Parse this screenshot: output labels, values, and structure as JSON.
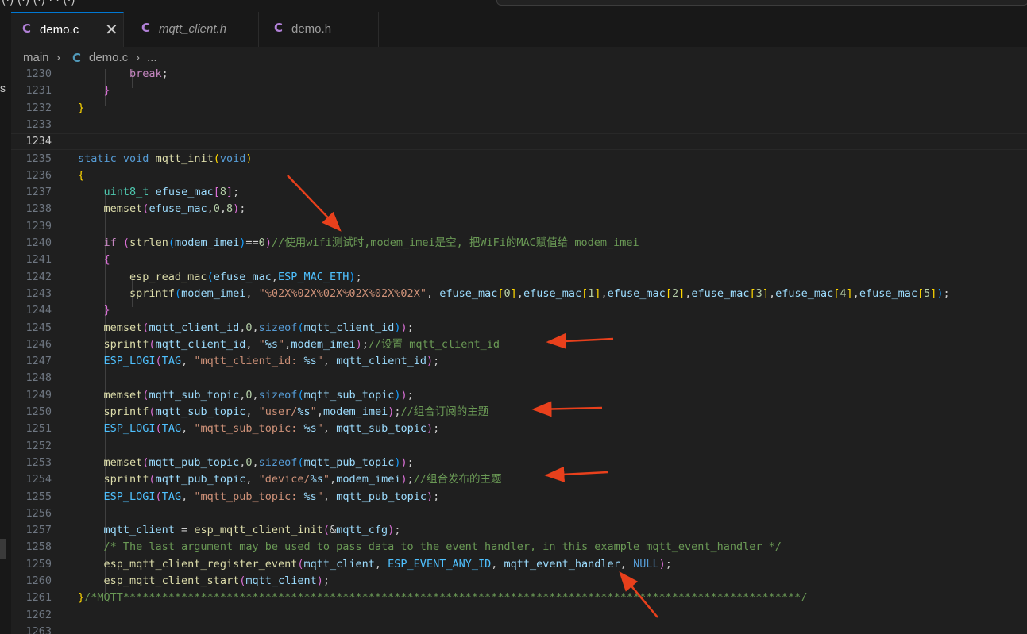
{
  "window": {
    "menu_remnant": "(·)  (·)  (·)  ·  ·  (·)"
  },
  "edge_label": "s",
  "tabs": [
    {
      "icon": "C",
      "label": "demo.c",
      "active": true,
      "italic": false,
      "close": "✕"
    },
    {
      "icon": "C",
      "label": "mqtt_client.h",
      "active": false,
      "italic": true
    },
    {
      "icon": "C",
      "label": "demo.h",
      "active": false,
      "italic": false
    }
  ],
  "breadcrumb": {
    "folder": "main",
    "sep1": "›",
    "icon": "C",
    "file": "demo.c",
    "sep2": "›",
    "tail": "..."
  },
  "colors": {
    "keyword": "#569cd6",
    "type": "#4ec9b0",
    "function": "#dcdcaa",
    "variable": "#9cdcfe",
    "number": "#b5cea8",
    "string": "#ce9178",
    "comment": "#6a9955",
    "macro": "#4fc1ff",
    "control": "#c586c0",
    "accent_tab": "#0078d4",
    "c_icon_tab": "#b180d7",
    "c_icon_crumb": "#519aba",
    "annotation_arrow": "#e8401c"
  },
  "editor": {
    "current_line": "1234",
    "lines": [
      {
        "n": "1230",
        "tokens": [
          [
            "        ",
            ""
          ],
          [
            "break",
            "ctl"
          ],
          [
            ";",
            ""
          ]
        ]
      },
      {
        "n": "1231",
        "tokens": [
          [
            "    ",
            ""
          ],
          [
            "}",
            "p2"
          ]
        ]
      },
      {
        "n": "1232",
        "tokens": [
          [
            "}",
            "p1"
          ]
        ]
      },
      {
        "n": "1233",
        "tokens": []
      },
      {
        "n": "1234",
        "tokens": []
      },
      {
        "n": "1235",
        "tokens": [
          [
            "static",
            "kw"
          ],
          [
            " ",
            ""
          ],
          [
            "void",
            "kw"
          ],
          [
            " ",
            ""
          ],
          [
            "mqtt_init",
            "fn"
          ],
          [
            "(",
            "p1"
          ],
          [
            "void",
            "kw"
          ],
          [
            ")",
            "p1"
          ]
        ]
      },
      {
        "n": "1236",
        "tokens": [
          [
            "{",
            "p1"
          ]
        ]
      },
      {
        "n": "1237",
        "tokens": [
          [
            "    ",
            ""
          ],
          [
            "uint8_t",
            "ty"
          ],
          [
            " ",
            ""
          ],
          [
            "efuse_mac",
            "var"
          ],
          [
            "[",
            "p2"
          ],
          [
            "8",
            "num"
          ],
          [
            "]",
            "p2"
          ],
          [
            ";",
            ""
          ]
        ]
      },
      {
        "n": "1238",
        "tokens": [
          [
            "    ",
            ""
          ],
          [
            "memset",
            "fn"
          ],
          [
            "(",
            "p2"
          ],
          [
            "efuse_mac",
            "var"
          ],
          [
            ",",
            ""
          ],
          [
            "0",
            "num"
          ],
          [
            ",",
            ""
          ],
          [
            "8",
            "num"
          ],
          [
            ")",
            "p2"
          ],
          [
            ";",
            ""
          ]
        ]
      },
      {
        "n": "1239",
        "tokens": []
      },
      {
        "n": "1240",
        "tokens": [
          [
            "    ",
            ""
          ],
          [
            "if",
            "ctl"
          ],
          [
            " ",
            ""
          ],
          [
            "(",
            "p2"
          ],
          [
            "strlen",
            "fn"
          ],
          [
            "(",
            "p3"
          ],
          [
            "modem_imei",
            "var"
          ],
          [
            ")",
            "p3"
          ],
          [
            "==",
            "op"
          ],
          [
            "0",
            "num"
          ],
          [
            ")",
            "p2"
          ],
          [
            "//使用wifi测试时,modem_imei是空, 把WiFi的MAC赋值给 modem_imei",
            "cm"
          ]
        ]
      },
      {
        "n": "1241",
        "tokens": [
          [
            "    ",
            ""
          ],
          [
            "{",
            "p2"
          ]
        ]
      },
      {
        "n": "1242",
        "tokens": [
          [
            "        ",
            ""
          ],
          [
            "esp_read_mac",
            "fn"
          ],
          [
            "(",
            "p3"
          ],
          [
            "efuse_mac",
            "var"
          ],
          [
            ",",
            ""
          ],
          [
            "ESP_MAC_ETH",
            "mac"
          ],
          [
            ")",
            "p3"
          ],
          [
            ";",
            ""
          ]
        ]
      },
      {
        "n": "1243",
        "tokens": [
          [
            "        ",
            ""
          ],
          [
            "sprintf",
            "fn"
          ],
          [
            "(",
            "p3"
          ],
          [
            "modem_imei",
            "var"
          ],
          [
            ", ",
            ""
          ],
          [
            "\"%02X%02X%02X%02X%02X%02X\"",
            "str"
          ],
          [
            ", ",
            ""
          ],
          [
            "efuse_mac",
            "var"
          ],
          [
            "[",
            "p1"
          ],
          [
            "0",
            "num"
          ],
          [
            "]",
            "p1"
          ],
          [
            ",",
            ""
          ],
          [
            "efuse_mac",
            "var"
          ],
          [
            "[",
            "p1"
          ],
          [
            "1",
            "num"
          ],
          [
            "]",
            "p1"
          ],
          [
            ",",
            ""
          ],
          [
            "efuse_mac",
            "var"
          ],
          [
            "[",
            "p1"
          ],
          [
            "2",
            "num"
          ],
          [
            "]",
            "p1"
          ],
          [
            ",",
            ""
          ],
          [
            "efuse_mac",
            "var"
          ],
          [
            "[",
            "p1"
          ],
          [
            "3",
            "num"
          ],
          [
            "]",
            "p1"
          ],
          [
            ",",
            ""
          ],
          [
            "efuse_mac",
            "var"
          ],
          [
            "[",
            "p1"
          ],
          [
            "4",
            "num"
          ],
          [
            "]",
            "p1"
          ],
          [
            ",",
            ""
          ],
          [
            "efuse_mac",
            "var"
          ],
          [
            "[",
            "p1"
          ],
          [
            "5",
            "num"
          ],
          [
            "]",
            "p1"
          ],
          [
            ")",
            "p3"
          ],
          [
            ";",
            ""
          ]
        ]
      },
      {
        "n": "1244",
        "tokens": [
          [
            "    ",
            ""
          ],
          [
            "}",
            "p2"
          ]
        ]
      },
      {
        "n": "1245",
        "tokens": [
          [
            "    ",
            ""
          ],
          [
            "memset",
            "fn"
          ],
          [
            "(",
            "p2"
          ],
          [
            "mqtt_client_id",
            "var"
          ],
          [
            ",",
            ""
          ],
          [
            "0",
            "num"
          ],
          [
            ",",
            ""
          ],
          [
            "sizeof",
            "kw"
          ],
          [
            "(",
            "p3"
          ],
          [
            "mqtt_client_id",
            "var"
          ],
          [
            ")",
            "p3"
          ],
          [
            ")",
            "p2"
          ],
          [
            ";",
            ""
          ]
        ]
      },
      {
        "n": "1246",
        "tokens": [
          [
            "    ",
            ""
          ],
          [
            "sprintf",
            "fn"
          ],
          [
            "(",
            "p2"
          ],
          [
            "mqtt_client_id",
            "var"
          ],
          [
            ", ",
            ""
          ],
          [
            "\"",
            "str"
          ],
          [
            "%s",
            "var"
          ],
          [
            "\"",
            "str"
          ],
          [
            ",",
            ""
          ],
          [
            "modem_imei",
            "var"
          ],
          [
            ")",
            "p2"
          ],
          [
            ";",
            ""
          ],
          [
            "//设置 mqtt_client_id",
            "cm"
          ]
        ]
      },
      {
        "n": "1247",
        "tokens": [
          [
            "    ",
            ""
          ],
          [
            "ESP_LOGI",
            "mac"
          ],
          [
            "(",
            "p2"
          ],
          [
            "TAG",
            "mac"
          ],
          [
            ", ",
            ""
          ],
          [
            "\"mqtt_client_id: ",
            "str"
          ],
          [
            "%s",
            "var"
          ],
          [
            "\"",
            "str"
          ],
          [
            ", ",
            ""
          ],
          [
            "mqtt_client_id",
            "var"
          ],
          [
            ")",
            "p2"
          ],
          [
            ";",
            ""
          ]
        ]
      },
      {
        "n": "1248",
        "tokens": []
      },
      {
        "n": "1249",
        "tokens": [
          [
            "    ",
            ""
          ],
          [
            "memset",
            "fn"
          ],
          [
            "(",
            "p2"
          ],
          [
            "mqtt_sub_topic",
            "var"
          ],
          [
            ",",
            ""
          ],
          [
            "0",
            "num"
          ],
          [
            ",",
            ""
          ],
          [
            "sizeof",
            "kw"
          ],
          [
            "(",
            "p3"
          ],
          [
            "mqtt_sub_topic",
            "var"
          ],
          [
            ")",
            "p3"
          ],
          [
            ")",
            "p2"
          ],
          [
            ";",
            ""
          ]
        ]
      },
      {
        "n": "1250",
        "tokens": [
          [
            "    ",
            ""
          ],
          [
            "sprintf",
            "fn"
          ],
          [
            "(",
            "p2"
          ],
          [
            "mqtt_sub_topic",
            "var"
          ],
          [
            ", ",
            ""
          ],
          [
            "\"user/",
            "str"
          ],
          [
            "%s",
            "var"
          ],
          [
            "\"",
            "str"
          ],
          [
            ",",
            ""
          ],
          [
            "modem_imei",
            "var"
          ],
          [
            ")",
            "p2"
          ],
          [
            ";",
            ""
          ],
          [
            "//组合订阅的主题",
            "cm"
          ]
        ]
      },
      {
        "n": "1251",
        "tokens": [
          [
            "    ",
            ""
          ],
          [
            "ESP_LOGI",
            "mac"
          ],
          [
            "(",
            "p2"
          ],
          [
            "TAG",
            "mac"
          ],
          [
            ", ",
            ""
          ],
          [
            "\"mqtt_sub_topic: ",
            "str"
          ],
          [
            "%s",
            "var"
          ],
          [
            "\"",
            "str"
          ],
          [
            ", ",
            ""
          ],
          [
            "mqtt_sub_topic",
            "var"
          ],
          [
            ")",
            "p2"
          ],
          [
            ";",
            ""
          ]
        ]
      },
      {
        "n": "1252",
        "tokens": []
      },
      {
        "n": "1253",
        "tokens": [
          [
            "    ",
            ""
          ],
          [
            "memset",
            "fn"
          ],
          [
            "(",
            "p2"
          ],
          [
            "mqtt_pub_topic",
            "var"
          ],
          [
            ",",
            ""
          ],
          [
            "0",
            "num"
          ],
          [
            ",",
            ""
          ],
          [
            "sizeof",
            "kw"
          ],
          [
            "(",
            "p3"
          ],
          [
            "mqtt_pub_topic",
            "var"
          ],
          [
            ")",
            "p3"
          ],
          [
            ")",
            "p2"
          ],
          [
            ";",
            ""
          ]
        ]
      },
      {
        "n": "1254",
        "tokens": [
          [
            "    ",
            ""
          ],
          [
            "sprintf",
            "fn"
          ],
          [
            "(",
            "p2"
          ],
          [
            "mqtt_pub_topic",
            "var"
          ],
          [
            ", ",
            ""
          ],
          [
            "\"device/",
            "str"
          ],
          [
            "%s",
            "var"
          ],
          [
            "\"",
            "str"
          ],
          [
            ",",
            ""
          ],
          [
            "modem_imei",
            "var"
          ],
          [
            ")",
            "p2"
          ],
          [
            ";",
            ""
          ],
          [
            "//组合发布的主题",
            "cm"
          ]
        ]
      },
      {
        "n": "1255",
        "tokens": [
          [
            "    ",
            ""
          ],
          [
            "ESP_LOGI",
            "mac"
          ],
          [
            "(",
            "p2"
          ],
          [
            "TAG",
            "mac"
          ],
          [
            ", ",
            ""
          ],
          [
            "\"mqtt_pub_topic: ",
            "str"
          ],
          [
            "%s",
            "var"
          ],
          [
            "\"",
            "str"
          ],
          [
            ", ",
            ""
          ],
          [
            "mqtt_pub_topic",
            "var"
          ],
          [
            ")",
            "p2"
          ],
          [
            ";",
            ""
          ]
        ]
      },
      {
        "n": "1256",
        "tokens": []
      },
      {
        "n": "1257",
        "tokens": [
          [
            "    ",
            ""
          ],
          [
            "mqtt_client",
            "var"
          ],
          [
            " = ",
            ""
          ],
          [
            "esp_mqtt_client_init",
            "fn"
          ],
          [
            "(",
            "p2"
          ],
          [
            "&",
            ""
          ],
          [
            "mqtt_cfg",
            "var"
          ],
          [
            ")",
            "p2"
          ],
          [
            ";",
            ""
          ]
        ]
      },
      {
        "n": "1258",
        "tokens": [
          [
            "    ",
            ""
          ],
          [
            "/* The last argument may be used to pass data to the event handler, in this example mqtt_event_handler */",
            "cm"
          ]
        ]
      },
      {
        "n": "1259",
        "tokens": [
          [
            "    ",
            ""
          ],
          [
            "esp_mqtt_client_register_event",
            "fn"
          ],
          [
            "(",
            "p2"
          ],
          [
            "mqtt_client",
            "var"
          ],
          [
            ", ",
            ""
          ],
          [
            "ESP_EVENT_ANY_ID",
            "mac"
          ],
          [
            ", ",
            ""
          ],
          [
            "mqtt_event_handler",
            "var"
          ],
          [
            ", ",
            ""
          ],
          [
            "NULL",
            "kw"
          ],
          [
            ")",
            "p2"
          ],
          [
            ";",
            ""
          ]
        ]
      },
      {
        "n": "1260",
        "tokens": [
          [
            "    ",
            ""
          ],
          [
            "esp_mqtt_client_start",
            "fn"
          ],
          [
            "(",
            "p2"
          ],
          [
            "mqtt_client",
            "var"
          ],
          [
            ")",
            "p2"
          ],
          [
            ";",
            ""
          ]
        ]
      },
      {
        "n": "1261",
        "tokens": [
          [
            "}",
            "p1"
          ],
          [
            "/*MQTT*********************************************************************************************************/",
            "cm"
          ]
        ]
      },
      {
        "n": "1262",
        "tokens": []
      },
      {
        "n": "1263",
        "tokens": []
      }
    ]
  }
}
